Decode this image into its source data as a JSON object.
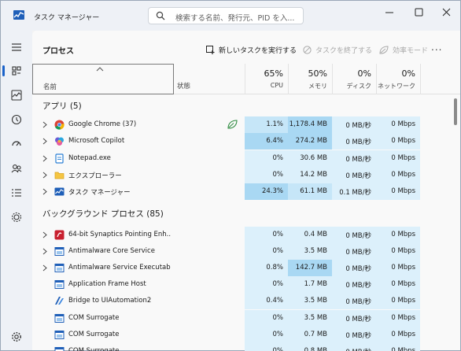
{
  "window": {
    "title": "タスク マネージャー",
    "search_placeholder": "検索する名前、発行元、PID を入..."
  },
  "nav": {
    "items": [
      "menu",
      "processes",
      "performance",
      "app-history",
      "startup-apps",
      "users",
      "details",
      "services"
    ],
    "active": "processes"
  },
  "page": {
    "title": "プロセス",
    "run_new_task": "新しいタスクを実行する",
    "end_task": "タスクを終了する",
    "efficiency_mode": "効率モード",
    "more": "..."
  },
  "columns": {
    "name": "名前",
    "status": "状態",
    "cpu_pct": "65%",
    "cpu_label": "CPU",
    "mem_pct": "50%",
    "mem_label": "メモリ",
    "disk_pct": "0%",
    "disk_label": "ディスク",
    "net_pct": "0%",
    "net_label": "ネットワーク"
  },
  "groups": {
    "apps": "アプリ (5)",
    "background": "バックグラウンド プロセス (85)"
  },
  "apps": [
    {
      "name": "Google Chrome (37)",
      "icon": "chrome-icon",
      "cpu": "1.1%",
      "mem": "1,178.4 MB",
      "disk": "0 MB/秒",
      "net": "0 Mbps",
      "expandable": true,
      "status_icon": true
    },
    {
      "name": "Microsoft Copilot",
      "icon": "copilot-icon",
      "cpu": "6.4%",
      "mem": "274.2 MB",
      "disk": "0 MB/秒",
      "net": "0 Mbps",
      "expandable": true
    },
    {
      "name": "Notepad.exe",
      "icon": "notepad-icon",
      "cpu": "0%",
      "mem": "30.6 MB",
      "disk": "0 MB/秒",
      "net": "0 Mbps",
      "expandable": true
    },
    {
      "name": "エクスプローラー",
      "icon": "folder-icon",
      "cpu": "0%",
      "mem": "14.2 MB",
      "disk": "0 MB/秒",
      "net": "0 Mbps",
      "expandable": true
    },
    {
      "name": "タスク マネージャー",
      "icon": "task-manager-icon",
      "cpu": "24.3%",
      "mem": "61.1 MB",
      "disk": "0.1 MB/秒",
      "net": "0 Mbps",
      "expandable": true
    }
  ],
  "background": [
    {
      "name": "64-bit Synaptics Pointing Enh...",
      "icon": "synaptics-icon",
      "cpu": "0%",
      "mem": "0.4 MB",
      "disk": "0 MB/秒",
      "net": "0 Mbps",
      "expandable": true
    },
    {
      "name": "Antimalware Core Service",
      "icon": "service-icon",
      "cpu": "0%",
      "mem": "3.5 MB",
      "disk": "0 MB/秒",
      "net": "0 Mbps",
      "expandable": true
    },
    {
      "name": "Antimalware Service Executable",
      "icon": "service-icon",
      "cpu": "0.8%",
      "mem": "142.7 MB",
      "disk": "0 MB/秒",
      "net": "0 Mbps",
      "expandable": true
    },
    {
      "name": "Application Frame Host",
      "icon": "service-icon",
      "cpu": "0%",
      "mem": "1.7 MB",
      "disk": "0 MB/秒",
      "net": "0 Mbps",
      "expandable": false
    },
    {
      "name": "Bridge to UIAutomation2",
      "icon": "bridge-icon",
      "cpu": "0.4%",
      "mem": "3.5 MB",
      "disk": "0 MB/秒",
      "net": "0 Mbps",
      "expandable": false
    },
    {
      "name": "COM Surrogate",
      "icon": "service-icon",
      "cpu": "0%",
      "mem": "3.5 MB",
      "disk": "0 MB/秒",
      "net": "0 Mbps",
      "expandable": false
    },
    {
      "name": "COM Surrogate",
      "icon": "service-icon",
      "cpu": "0%",
      "mem": "0.7 MB",
      "disk": "0 MB/秒",
      "net": "0 Mbps",
      "expandable": false
    },
    {
      "name": "COM Surrogate",
      "icon": "service-icon",
      "cpu": "0%",
      "mem": "0.8 MB",
      "disk": "0 MB/秒",
      "net": "0 Mbps",
      "expandable": false
    }
  ],
  "colors": {
    "accent": "#1a62c9",
    "heat_low": "#dcf0fb",
    "heat_mid": "#c6e6f8",
    "heat_high": "#a9d8f3"
  }
}
